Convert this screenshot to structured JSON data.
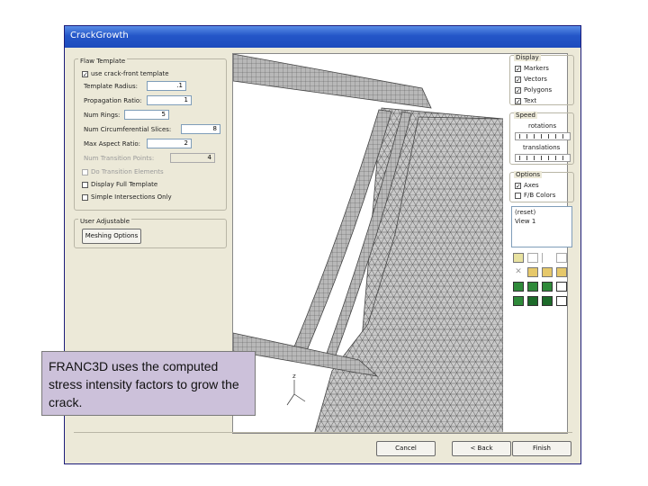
{
  "window": {
    "title": "CrackGrowth"
  },
  "flaw_template": {
    "label": "Flaw Template",
    "use_template_label": "use crack-front template",
    "fields": [
      {
        "label": "Template Radius:",
        "value": ".1"
      },
      {
        "label": "Propagation Ratio:",
        "value": "1"
      },
      {
        "label": "Num Rings:",
        "value": "5"
      },
      {
        "label": "Num Circumferential Slices:",
        "value": "8"
      },
      {
        "label": "Max Aspect Ratio:",
        "value": "2"
      },
      {
        "label": "Num Transition Points:",
        "value": "4"
      }
    ],
    "options": [
      {
        "label": "Do Transition Elements",
        "disabled": true
      },
      {
        "label": "Display Full Template",
        "disabled": false
      },
      {
        "label": "Simple Intersections Only",
        "disabled": false
      }
    ]
  },
  "user_adjustable": {
    "label": "User Adjustable",
    "meshing_button": "Meshing Options"
  },
  "display": {
    "label": "Display",
    "items": [
      {
        "label": "Markers",
        "checked": true
      },
      {
        "label": "Vectors",
        "checked": true
      },
      {
        "label": "Polygons",
        "checked": true
      },
      {
        "label": "Text",
        "checked": true
      }
    ]
  },
  "speed": {
    "label": "Speed",
    "rotations": "rotations",
    "translations": "translations"
  },
  "options": {
    "label": "Options",
    "items": [
      {
        "label": "Axes",
        "checked": true
      },
      {
        "label": "F/B Colors",
        "checked": false
      }
    ]
  },
  "view_list": [
    "(reset)",
    "View 1"
  ],
  "viewport": {
    "axis_label": "z"
  },
  "buttons": {
    "cancel": "Cancel",
    "back": "< Back",
    "finish": "Finish"
  },
  "caption": "FRANC3D uses the computed stress intensity factors to grow the crack."
}
